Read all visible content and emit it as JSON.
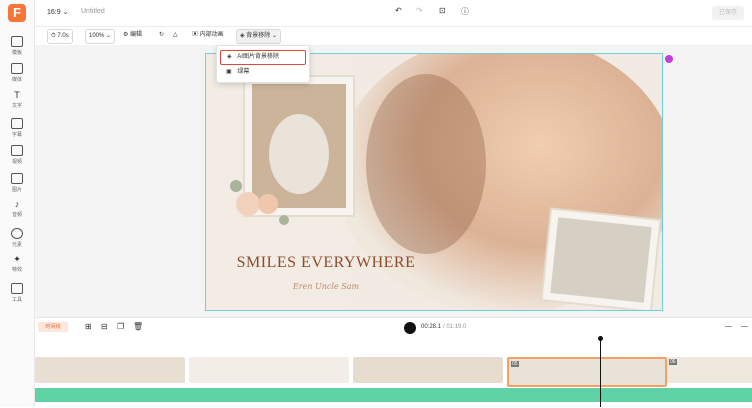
{
  "app": {
    "logo_letter": "F"
  },
  "sidebar": {
    "items": [
      {
        "label": "模板",
        "icon": "template-icon"
      },
      {
        "label": "媒体",
        "icon": "media-icon"
      },
      {
        "label": "文字",
        "icon": "text-icon"
      },
      {
        "label": "字幕",
        "icon": "subtitle-icon"
      },
      {
        "label": "视频",
        "icon": "video-icon"
      },
      {
        "label": "图片",
        "icon": "image-icon"
      },
      {
        "label": "音频",
        "icon": "audio-icon"
      },
      {
        "label": "元素",
        "icon": "elements-icon"
      },
      {
        "label": "特效",
        "icon": "effects-icon"
      },
      {
        "label": "工具",
        "icon": "tools-icon"
      }
    ]
  },
  "topbar": {
    "aspect_ratio": "16:9",
    "title": "Untitled",
    "export_label": "已保存"
  },
  "toolbar": {
    "duration": "7.0s",
    "zoom": "100%",
    "edit_label": "编辑",
    "anim_label": "内部动画",
    "bg_remove_label": "背景移除"
  },
  "dropdown": {
    "items": [
      {
        "label": "AI图片背景移除"
      },
      {
        "label": "绿幕"
      }
    ]
  },
  "canvas": {
    "headline": "SMILES EVERYWHERE",
    "subtitle": "Eren Uncle Sam"
  },
  "timeline": {
    "label": "时间线",
    "current_time": "00:28.1",
    "total_time": "/ 01:19.0",
    "clip_labels": [
      "05",
      "06"
    ]
  },
  "colors": {
    "accent": "#f6763a",
    "selection": "#6fd2d8",
    "highlight_box": "#e0463b",
    "waveform": "#5fd3a6"
  }
}
